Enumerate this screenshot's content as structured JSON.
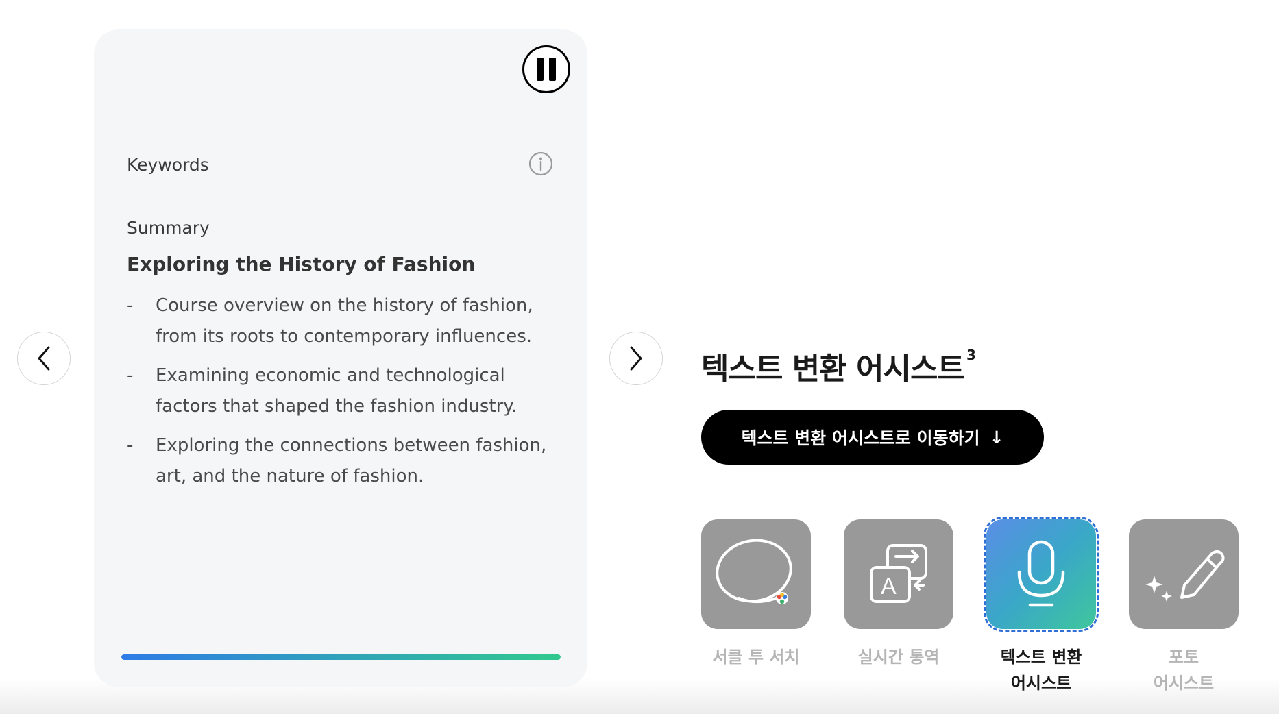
{
  "nav": {
    "prev_icon": "chevron-left-icon",
    "next_icon": "chevron-right-icon"
  },
  "card": {
    "pause_icon": "pause-icon",
    "keywords_label": "Keywords",
    "info_icon": "info-icon",
    "summary_label": "Summary",
    "summary_title": "Exploring the History of Fashion",
    "bullets": [
      {
        "dash": "-",
        "text": "Course overview on the history of fashion, from its roots to contemporary influences."
      },
      {
        "dash": "-",
        "text": "Examining economic and technological factors that shaped the fashion industry."
      },
      {
        "dash": "-",
        "text": "Exploring the connections between fashion, art, and the nature of fashion."
      }
    ],
    "progress": 1.0,
    "progress_colors": [
      "#2e7be6",
      "#31c98e"
    ]
  },
  "feature": {
    "title": "텍스트 변환 어시스트",
    "footnote": "3",
    "cta_label": "텍스트 변환 어시스트로 이동하기",
    "cta_arrow": "↓"
  },
  "tabs": [
    {
      "label_line1": "서클 투 서치",
      "label_line2": "",
      "icon": "circle-lasso-icon",
      "active": false
    },
    {
      "label_line1": "실시간 통역",
      "label_line2": "",
      "icon": "translate-icon",
      "active": false
    },
    {
      "label_line1": "텍스트 변환",
      "label_line2": "어시스트",
      "icon": "microphone-icon",
      "active": true
    },
    {
      "label_line1": "포토",
      "label_line2": "어시스트",
      "icon": "pencil-sparkle-icon",
      "active": false
    }
  ],
  "colors": {
    "card_bg": "#f5f6f7",
    "tab_inactive": "#999999",
    "cta_bg": "#000000",
    "active_gradient": [
      "#5a8ee6",
      "#3aa7c8",
      "#3fc79c"
    ]
  }
}
